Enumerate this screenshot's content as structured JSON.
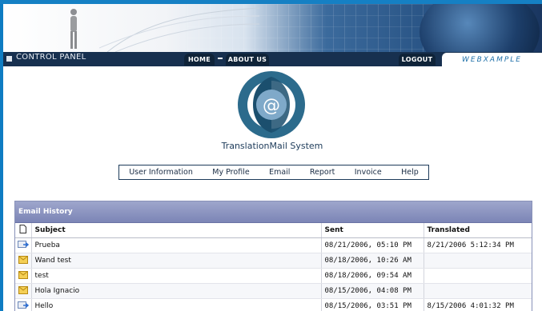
{
  "nav": {
    "control_panel": "CONTROL PANEL",
    "home": "HOME",
    "about": "ABOUT US",
    "logout": "LOGOUT",
    "brand": "WEBXAMPLE"
  },
  "logo": {
    "title": "TranslationMail System"
  },
  "menu": [
    "User Information",
    "My Profile",
    "Email",
    "Report",
    "Invoice",
    "Help"
  ],
  "email_history": {
    "title": "Email History",
    "columns": {
      "subject": "Subject",
      "sent": "Sent",
      "translated": "Translated"
    },
    "rows": [
      {
        "icon": "forward-mail-icon",
        "subject": "Prueba",
        "sent": "08/21/2006, 05:10 PM",
        "translated": "8/21/2006 5:12:34 PM"
      },
      {
        "icon": "envelope-icon",
        "subject": "Wand test",
        "sent": "08/18/2006, 10:26 AM",
        "translated": ""
      },
      {
        "icon": "envelope-icon",
        "subject": "test",
        "sent": "08/18/2006, 09:54 AM",
        "translated": ""
      },
      {
        "icon": "envelope-icon",
        "subject": "Hola Ignacio",
        "sent": "08/15/2006, 04:08 PM",
        "translated": ""
      },
      {
        "icon": "forward-mail-icon",
        "subject": "Hello",
        "sent": "08/15/2006, 03:51 PM",
        "translated": "8/15/2006 4:01:32 PM"
      }
    ]
  },
  "colors": {
    "navbar": "#17304f",
    "panel_header": "#8891b8",
    "accent": "#0e7cc2"
  }
}
